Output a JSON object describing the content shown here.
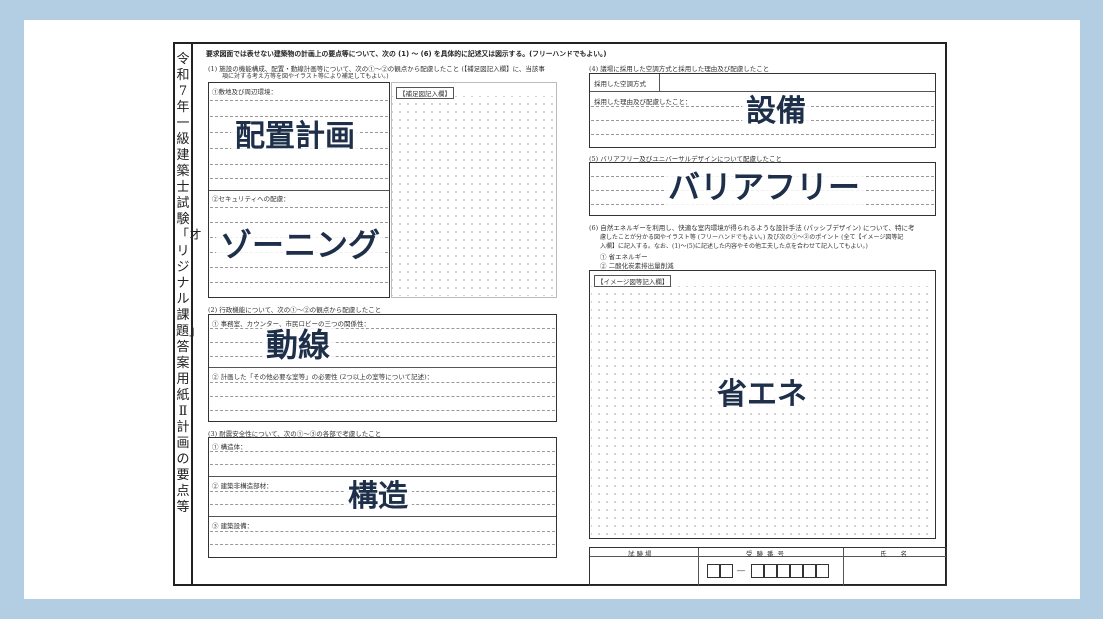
{
  "vertical_title": "令和7年一級建築士試験「オリジナル課題」答案用紙Ⅱ計画の要点等",
  "instruction": "要求図面では表せない建築物の計画上の要点等について、次の (1) ～ (6) を具体的に記述又は図示する。(フリーハンドでもよい。)",
  "q1": {
    "heading": "(1) 施設の機能構成、配置・動線計画等について、次の①～②の観点から配慮したこと (【補足図記入欄】に、当該事",
    "heading_cont": "項に対する考え方等を図やイラスト等により補足してもよい。)",
    "item1": "①敷地及び周辺環境：",
    "item2": "②セキュリティへの配慮：",
    "supplement_label": "【補足図記入欄】"
  },
  "q2": {
    "heading": "(2) 行政機能について、次の①～②の観点から配慮したこと",
    "item1": "① 事務室、カウンター、市民ロビーの三つの関係性：",
    "item2": "② 計画した「その他必要な室等」の必要性 (2つ以上の室等について記述)："
  },
  "q3": {
    "heading": "(3) 耐震安全性について、次の①～③の各部で考慮したこと",
    "item1": "① 構造体：",
    "item2": "② 建築非構造部材：",
    "item3": "③ 建築設備："
  },
  "q4": {
    "heading": "(4) 議場に採用した空調方式と採用した理由及び配慮したこと",
    "item1": "採用した空調方式",
    "item2": "採用した理由及び配慮したこと："
  },
  "q5": {
    "heading": "(5) バリアフリー及びユニバーサルデザインについて配慮したこと"
  },
  "q6": {
    "line1": "(6) 自然エネルギーを利用し、快適な室内環境が得られるような設計手法 (パッシブデザイン) について、特に考",
    "line2": "慮したことが分かる図やイラスト等 (フリーハンドでもよい。) 及び次の①～②のポイント (全て【イメージ図等記",
    "line3": "入欄】に記入する。なお、(1)～(5)に記述した内容やその他工夫した点を合わせて記入してもよい。)",
    "point1": "① 省エネルギー",
    "point2": "② 二酸化炭素排出量削減",
    "image_label": "【イメージ図等記入欄】"
  },
  "overlays": {
    "layout": "配置計画",
    "zoning": "ゾーニング",
    "circulation": "動線",
    "structure": "構造",
    "equipment": "設備",
    "barrier_free": "バリアフリー",
    "energy": "省エネ"
  },
  "footer": {
    "venue_label": "試験場",
    "number_label": "受験番号",
    "name_label": "氏名",
    "dash": "―"
  },
  "colors": {
    "background": "#b3cde2",
    "overlay_text": "#1e2f4a"
  }
}
